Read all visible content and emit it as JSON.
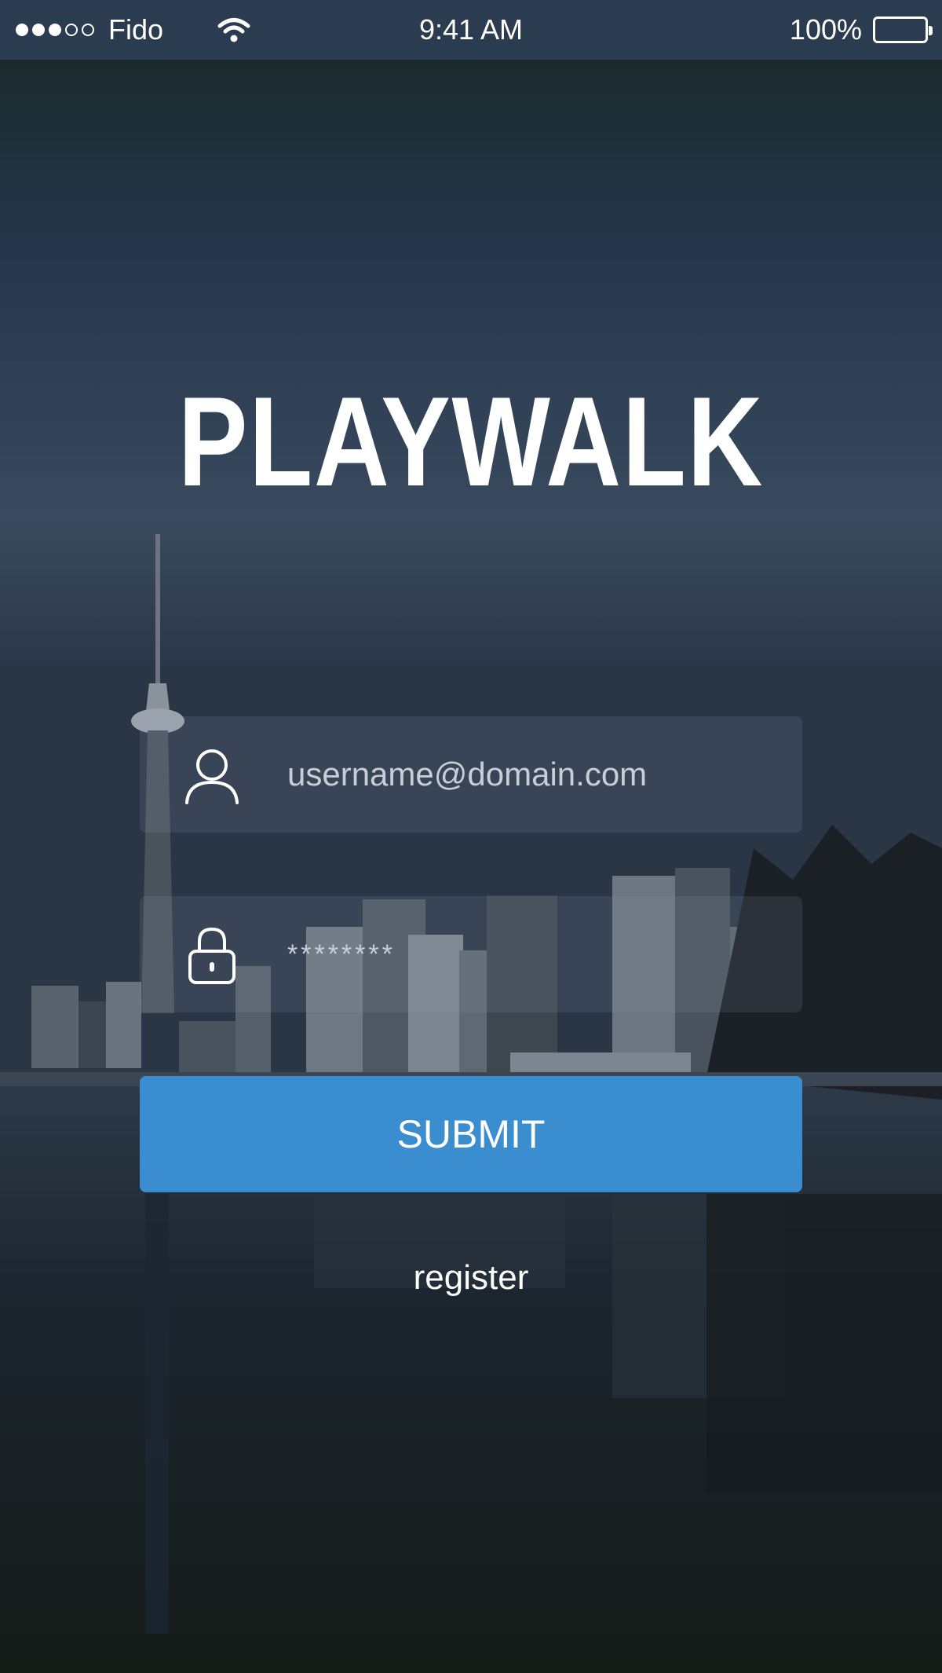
{
  "status_bar": {
    "carrier": "Fido",
    "time": "9:41 AM",
    "battery": "100%",
    "signal_bars": 3,
    "signal_total": 5
  },
  "app": {
    "logo_text": "PLAYWALK"
  },
  "login_form": {
    "username_placeholder": "username@domain.com",
    "password_placeholder": "********",
    "submit_label": "SUBMIT",
    "register_label": "register"
  },
  "icons": {
    "username": "user-icon",
    "password": "lock-icon",
    "wifi": "wifi-icon",
    "battery": "battery-icon"
  },
  "colors": {
    "status_bar": "#2c3c50",
    "submit_button": "#3a8ed0",
    "text": "#ffffff"
  }
}
